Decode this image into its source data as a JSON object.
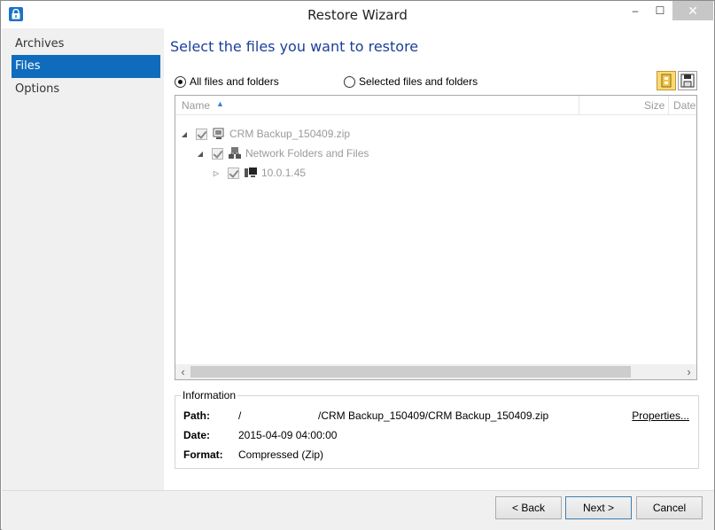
{
  "window": {
    "title": "Restore Wizard",
    "minimize_glyph": "–",
    "maximize_glyph": "☐",
    "close_glyph": "✕"
  },
  "sidebar": {
    "items": [
      {
        "label": "Archives",
        "active": false
      },
      {
        "label": "Files",
        "active": true
      },
      {
        "label": "Options",
        "active": false
      }
    ]
  },
  "main": {
    "heading": "Select the files you want to restore",
    "radio_all": {
      "label": "All files and folders",
      "selected": true
    },
    "radio_selected": {
      "label": "Selected files and folders",
      "selected": false
    },
    "toolbar_icons": [
      "restore-to-folder-icon",
      "save-icon"
    ]
  },
  "tree": {
    "columns": {
      "name": "Name",
      "size": "Size",
      "date": "Date"
    },
    "sort_glyph": "▲",
    "rows": [
      {
        "label": "CRM Backup_150409.zip",
        "expanded": true,
        "level": 0,
        "checked": true,
        "icon": "archive-computer-icon"
      },
      {
        "label": "Network Folders and Files",
        "expanded": true,
        "level": 1,
        "checked": true,
        "icon": "network-icon"
      },
      {
        "label": "10.0.1.45",
        "expanded": false,
        "level": 2,
        "checked": true,
        "icon": "server-icon"
      }
    ],
    "scroll_left": "‹",
    "scroll_right": "›"
  },
  "information": {
    "legend": "Information",
    "path_label": "Path:",
    "path_value": "/                          /CRM Backup_150409/CRM Backup_150409.zip",
    "date_label": "Date:",
    "date_value": "2015-04-09 04:00:00",
    "format_label": "Format:",
    "format_value": "Compressed (Zip)",
    "properties_link": "Properties..."
  },
  "footer": {
    "back": "< Back",
    "next": "Next >",
    "cancel": "Cancel"
  },
  "colors": {
    "accent": "#0f6cbd",
    "heading": "#1b3f9a",
    "sidebar_bg": "#f0f0f0"
  }
}
